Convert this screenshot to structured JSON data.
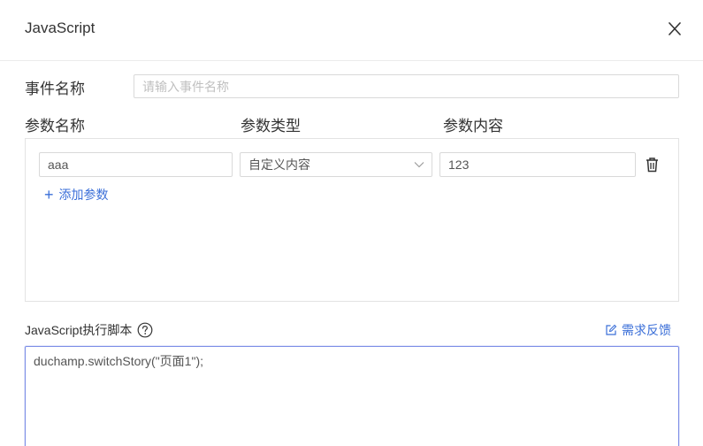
{
  "dialog": {
    "title": "JavaScript"
  },
  "event": {
    "label": "事件名称",
    "placeholder": "请输入事件名称",
    "value": ""
  },
  "params": {
    "headers": [
      "参数名称",
      "参数类型",
      "参数内容"
    ],
    "rows": [
      {
        "name": "aaa",
        "type": "自定义内容",
        "content": "123"
      }
    ],
    "add_label": "添加参数"
  },
  "script": {
    "label": "JavaScript执行脚本",
    "feedback_label": "需求反馈",
    "code": "duchamp.switchStory(\"页面1\");"
  },
  "colors": {
    "accent": "#3b6fd8",
    "border": "#d9d9d9",
    "focus_border": "#7b8de6"
  }
}
